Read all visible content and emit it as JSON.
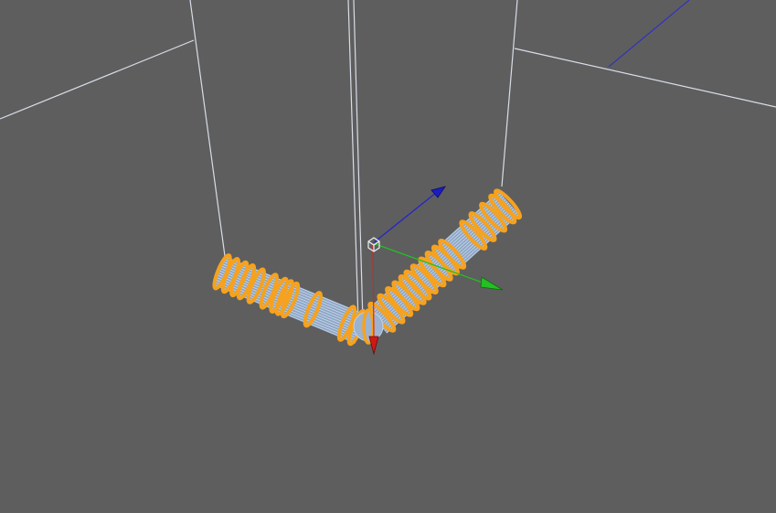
{
  "viewport": {
    "background_color": "#5e5e5e",
    "edge_color": "#d8dde8",
    "mesh_wire_color": "#c9d9ee",
    "selection_color": "#f6a21e"
  },
  "gizmo": {
    "x_axis_color": "#e02020",
    "y_axis_color": "#22c022",
    "z_axis_color": "#2222d0",
    "pivot_icon": "pivot-cube-icon"
  },
  "objects": [
    {
      "name": "bent-pipe-mesh",
      "state": "selected"
    }
  ]
}
